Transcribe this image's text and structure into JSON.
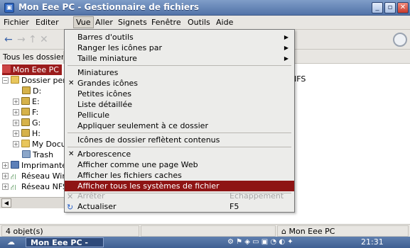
{
  "window": {
    "title": "Mon Eee PC - Gestionnaire de fichiers",
    "app_icon_glyph": "▣",
    "controls": {
      "minimize": "_",
      "maximize": "▫",
      "close": "✕"
    }
  },
  "menubar": [
    "Fichier",
    "Editer",
    "Vue",
    "Aller",
    "Signets",
    "Fenêtre",
    "Outils",
    "Aide"
  ],
  "toolbar": {
    "back": "←",
    "forward": "→",
    "up": "↑",
    "stop": "✕",
    "refresh_icon": "spinner"
  },
  "sidebar": {
    "label": "Tous les dossier",
    "tree": [
      {
        "label": "Mon Eee PC",
        "icon": "home-icon",
        "selected": true
      },
      {
        "label": "Dossier per",
        "icon": "home-folder-icon",
        "expander": "−"
      },
      {
        "label": "D:",
        "icon": "drive-icon"
      },
      {
        "label": "E:",
        "icon": "drive-icon",
        "expander": "+"
      },
      {
        "label": "F:",
        "icon": "drive-icon",
        "expander": "+"
      },
      {
        "label": "G:",
        "icon": "drive-icon",
        "expander": "+"
      },
      {
        "label": "H:",
        "icon": "drive-icon",
        "expander": "+"
      },
      {
        "label": "My Docu",
        "icon": "folder-icon",
        "expander": "+"
      },
      {
        "label": "Trash",
        "icon": "trash-icon"
      },
      {
        "label": "Imprimantes",
        "icon": "printer-icon",
        "expander": "+"
      },
      {
        "label": "Réseau Win",
        "icon": "network-icon",
        "expander": "+"
      },
      {
        "label": "Réseau NFS",
        "icon": "network-icon",
        "expander": "+"
      }
    ]
  },
  "main": {
    "visible_item": "NFS"
  },
  "view_menu": {
    "items": [
      {
        "label": "Barres d'outils",
        "submenu": true
      },
      {
        "label": "Ranger les icônes par",
        "submenu": true
      },
      {
        "label": "Taille miniature",
        "submenu": true
      },
      {
        "label": "Miniatures"
      },
      {
        "label": "Grandes icônes",
        "checked": true
      },
      {
        "label": "Petites icônes"
      },
      {
        "label": "Liste détaillée"
      },
      {
        "label": "Pellicule"
      },
      {
        "label": "Appliquer seulement à ce dossier"
      },
      {
        "label": "Icônes de dossier reflètent contenus"
      },
      {
        "label": "Arborescence",
        "checked": true
      },
      {
        "label": "Afficher comme une page Web"
      },
      {
        "label": "Afficher les fichiers caches"
      },
      {
        "label": "Afficher tous les systèmes de fichier",
        "highlighted": true
      },
      {
        "label": "Arrêter",
        "shortcut": "Echappement",
        "disabled": true,
        "icon": "stop-icon"
      },
      {
        "label": "Actualiser",
        "shortcut": "F5",
        "icon": "refresh-icon"
      }
    ],
    "submenu_arrow": "▶",
    "check_mark": "✕",
    "stop_glyph": "✕",
    "refresh_glyph": "↻"
  },
  "status": {
    "count": "4 objet(s)",
    "location": "Mon Eee PC",
    "location_icon": "⌂"
  },
  "taskbar": {
    "start_glyph": "☁",
    "task": "Mon Eee PC -",
    "tray": "⚙ ⚑ ◈ ▭ ▣ ◔ ◐ ✦",
    "clock": "21:31"
  },
  "colors": {
    "accent": "#8e1414",
    "titlebar": "#5273a8"
  }
}
